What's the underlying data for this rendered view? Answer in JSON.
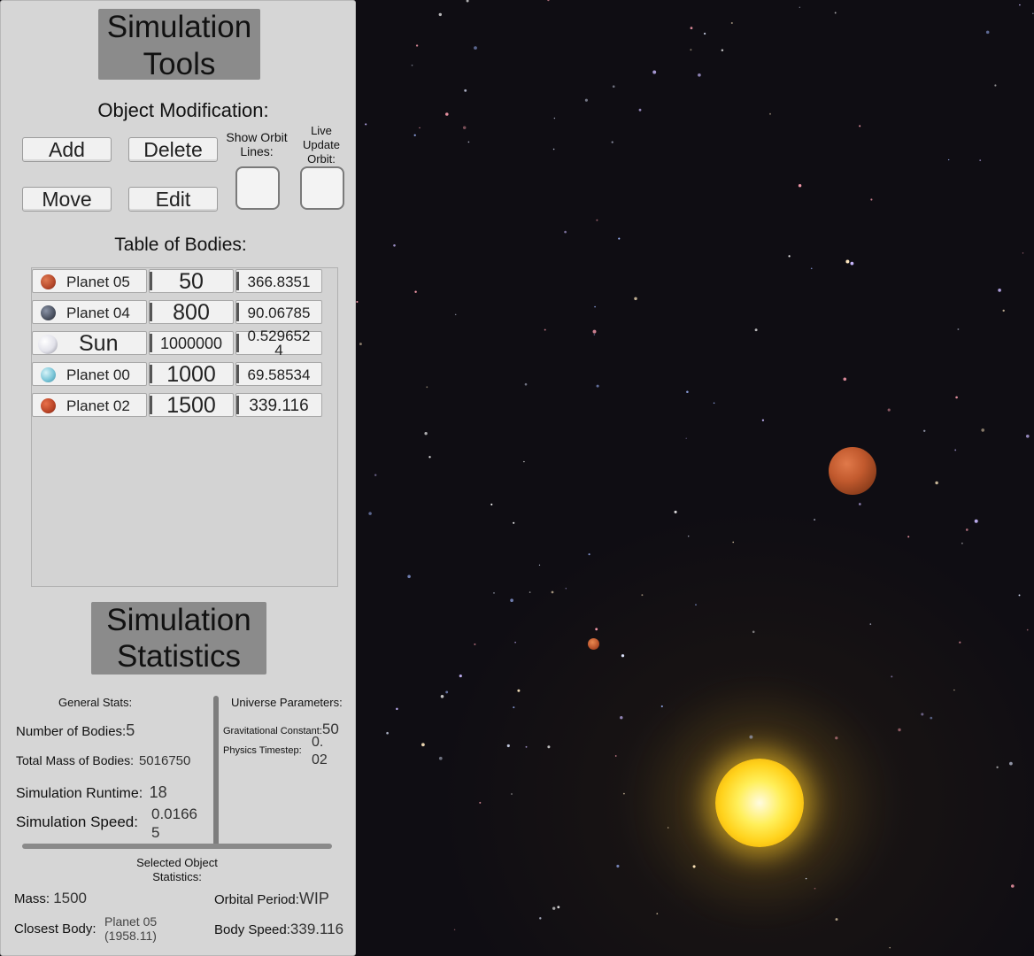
{
  "panel": {
    "tools_title_line1": "Simulation",
    "tools_title_line2": "Tools",
    "object_modification_label": "Object Modification:",
    "buttons": {
      "add": "Add",
      "delete": "Delete",
      "move": "Move",
      "edit": "Edit"
    },
    "show_orbit_lines_line1": "Show Orbit",
    "show_orbit_lines_line2": "Lines:",
    "live_update_line1": "Live",
    "live_update_line2": "Update",
    "live_update_line3": "Orbit:",
    "show_orbit_lines_checked": false,
    "live_update_orbit_checked": false,
    "table_title": "Table of Bodies:",
    "bodies": [
      {
        "name": "Planet 05",
        "mass": "50",
        "value": "366.8351",
        "icon": "planet-05-icon",
        "color": "#b5482a"
      },
      {
        "name": "Planet 04",
        "mass": "800",
        "value": "90.06785",
        "icon": "planet-04-icon",
        "color": "#4a5160"
      },
      {
        "name": "Sun",
        "mass": "1000000",
        "value_line1": "0.529652",
        "value_line2": "4",
        "icon": "sun-icon",
        "color": "#e8e8ee"
      },
      {
        "name": "Planet 00",
        "mass": "1000",
        "value": "69.58534",
        "icon": "planet-00-icon",
        "color": "#7cc6d8"
      },
      {
        "name": "Planet 02",
        "mass": "1500",
        "value": "339.116",
        "icon": "planet-02-icon",
        "color": "#b84326"
      }
    ],
    "stats_title_line1": "Simulation",
    "stats_title_line2": "Statistics",
    "general_stats_label": "General Stats:",
    "universe_params_label": "Universe Parameters:",
    "number_of_bodies_label": "Number of Bodies:",
    "number_of_bodies_value": "5",
    "total_mass_label": "Total Mass of Bodies:",
    "total_mass_value": "5016750",
    "runtime_label": "Simulation Runtime:",
    "runtime_value": "18",
    "speed_label": "Simulation Speed:",
    "speed_value_line1": "0.0166",
    "speed_value_line2": "5",
    "grav_const_label": "Gravitational Constant:",
    "grav_const_value": "50",
    "timestep_label": "Physics Timestep:",
    "timestep_value_line1": "0.",
    "timestep_value_line2": "02",
    "selected_label_line1": "Selected Object",
    "selected_label_line2": "Statistics:",
    "mass_label": "Mass:",
    "mass_value": "1500",
    "orbital_period_label": "Orbital Period:",
    "orbital_period_value": "WIP",
    "closest_body_label": "Closest Body:",
    "closest_body_value_line1": "Planet 05",
    "closest_body_value_line2": "(1958.11)",
    "body_speed_label": "Body Speed:",
    "body_speed_value": "339.116"
  },
  "colors": {
    "panel_bg": "#d6d6d6",
    "header_bg": "#8b8b8b",
    "space_bg": "#0f0d13",
    "sun": "#ffe23a",
    "planet": "#c25a2e"
  }
}
